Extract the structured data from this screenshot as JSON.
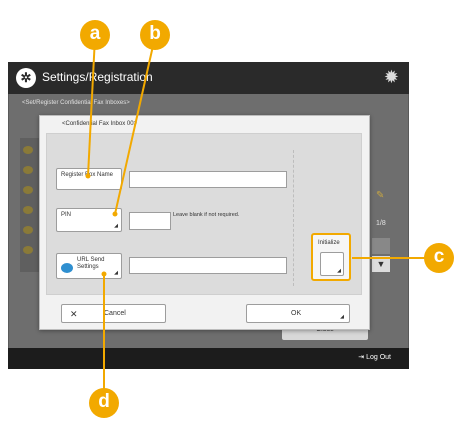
{
  "app": {
    "title": "Settings/Registration",
    "breadcrumb": "<Set/Register Confidential Fax Inboxes>",
    "page_indicator": "1/8",
    "logout_label": "Log Out",
    "close_label": "Close"
  },
  "dialog": {
    "title": "<Confidential Fax Inbox 00>",
    "register_box_name_label": "Register Box Name",
    "pin_label": "PIN",
    "pin_note": "Leave blank if not required.",
    "url_send_settings_label": "URL Send Settings",
    "initialize_label": "Initialize",
    "cancel_label": "Cancel",
    "ok_label": "OK"
  },
  "callouts": [
    "a",
    "b",
    "c",
    "d"
  ],
  "colors": {
    "accent": "#f2a900",
    "header_bg": "#2a2a2a",
    "dim_bg": "#6e6e6e"
  }
}
